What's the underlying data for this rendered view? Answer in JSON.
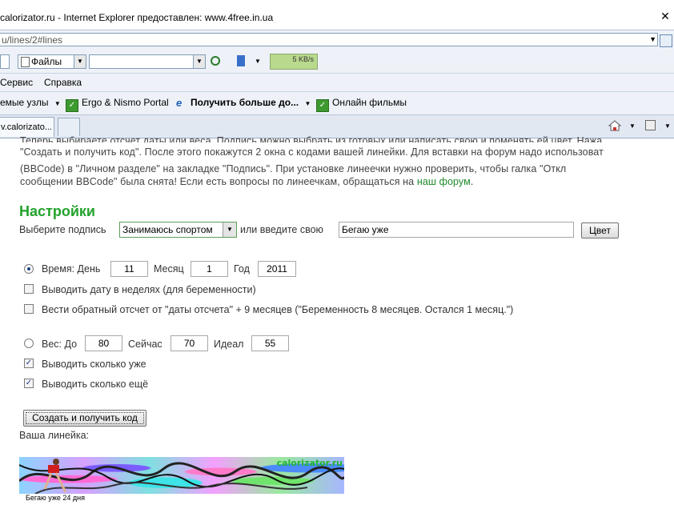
{
  "window": {
    "title": "calorizator.ru - Internet Explorer предоставлен: www.4free.in.ua",
    "close_glyph": "✕"
  },
  "address": {
    "url": "u/lines/2#lines"
  },
  "toolbar": {
    "files_label": "Файлы",
    "speed": "5 KB/s"
  },
  "menu": {
    "items": [
      "Сервис",
      "Справка"
    ]
  },
  "links_bar": {
    "items": [
      {
        "label": "емые узлы",
        "icon": "dropdown"
      },
      {
        "label": "Ergo & Nismo Portal",
        "icon": "check-icon"
      },
      {
        "label": "Получить больше до...",
        "icon": "ie-icon"
      },
      {
        "label": "Онлайн фильмы",
        "icon": "check-icon"
      }
    ]
  },
  "tabs": {
    "active_label": "v.calorizato..."
  },
  "content": {
    "paragraph_lines": [
      "Теперь выбираете отсчет даты или веса. Подпись можно выбрать из готовых или написать свою и поменять ей цвет. Нажа",
      "\"Создать и получить код\". После этого покажутся 2 окна с кодами вашей линейки. Для вставки на форум надо использоват",
      "(BBCode) в \"Личном разделе\" на закладке \"Подпись\". При установке линеечки нужно проверить, чтобы галка \"Откл",
      "сообщении BBCode\" была снята! Если есть вопросы по линеечкам, обращаться на "
    ],
    "forum_link": "наш форум",
    "period": ".",
    "settings_heading": "Настройки",
    "choose_sig_label": "Выберите подпись",
    "sig_selected": "Занимаюсь спортом",
    "or_enter_label": "или введите свою",
    "custom_sig_value": "Бегаю уже",
    "color_button": "Цвет",
    "time": {
      "label": "Время: День",
      "day": "11",
      "month_label": "Месяц",
      "month": "1",
      "year_label": "Год",
      "year": "2011",
      "selected": true
    },
    "opt_weeks": {
      "label": "Выводить дату в неделях (для беременности)",
      "checked": false
    },
    "opt_countdown": {
      "label": "Вести обратный отсчет от \"даты отсчета\" + 9 месяцев (\"Беременность 8 месяцев. Остался 1 месяц.\")",
      "checked": false
    },
    "weight": {
      "label": "Вес: До",
      "start": "80",
      "now_label": "Сейчас",
      "now": "70",
      "ideal_label": "Идеал",
      "ideal": "55",
      "selected": false
    },
    "opt_how_much_done": {
      "label": "Выводить сколько уже",
      "checked": true
    },
    "opt_how_much_left": {
      "label": "Выводить сколько ещё",
      "checked": true
    },
    "create_button": "Создать и получить код",
    "your_ruler_label": "Ваша линейка:",
    "ruler_brand": "calorizator.ru",
    "ruler_caption": "Бегаю уже 24 дня"
  }
}
